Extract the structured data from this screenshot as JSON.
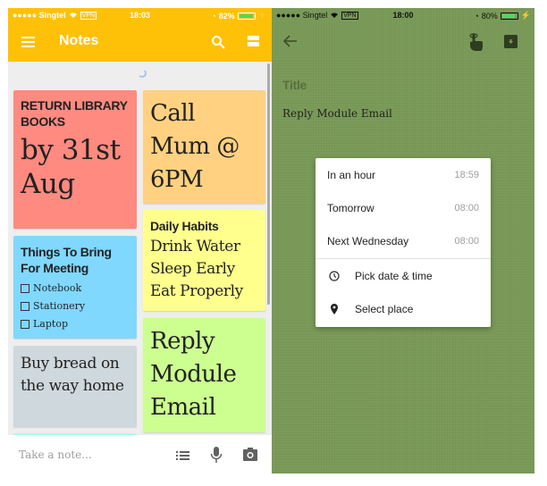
{
  "left_screen": {
    "status_bar": {
      "carrier": "●●●●● Singtel",
      "vpn": "VPN",
      "time": "18:03",
      "battery": "82%",
      "battery_level": 0.82
    },
    "toolbar": {
      "title": "Notes"
    },
    "notes": [
      {
        "title": "RETURN LIBRARY BOOKS",
        "body": "by 31st Aug",
        "color": "#ff8a80"
      },
      {
        "title": "",
        "body": "Call Mum @ 6PM",
        "color": "#ffd180"
      },
      {
        "title": "Daily Habits",
        "body_lines": [
          "Drink Water",
          "Sleep Early",
          "Eat Properly"
        ],
        "color": "#ffff8d"
      },
      {
        "title": "Things To Bring For Meeting",
        "checklist": [
          {
            "label": "Notebook",
            "checked": false
          },
          {
            "label": "Stationery",
            "checked": false
          },
          {
            "label": "Laptop",
            "checked": false
          }
        ],
        "color": "#80d8ff"
      },
      {
        "title": "",
        "body": "Buy bread on the way home",
        "color": "#cfd8dc"
      },
      {
        "title": "",
        "body": "Reply Module Email",
        "color": "#ccff90"
      },
      {
        "title": "",
        "body": "",
        "color": "#a7ffeb"
      }
    ],
    "bottom_bar": {
      "placeholder": "Take a note..."
    }
  },
  "right_screen": {
    "status_bar": {
      "carrier": "●●●●● Singtel",
      "vpn": "VPN",
      "time": "18:00",
      "battery": "80%",
      "battery_level": 0.8
    },
    "editor": {
      "title_placeholder": "Title",
      "body": "Reply Module Email",
      "background_color": "#7b9b59"
    },
    "reminder_menu": {
      "presets": [
        {
          "label": "In an hour",
          "time": "18:59"
        },
        {
          "label": "Tomorrow",
          "time": "08:00"
        },
        {
          "label": "Next Wednesday",
          "time": "08:00"
        }
      ],
      "options": [
        {
          "label": "Pick date & time",
          "icon": "clock-icon"
        },
        {
          "label": "Select place",
          "icon": "location-pin-icon"
        }
      ]
    }
  }
}
